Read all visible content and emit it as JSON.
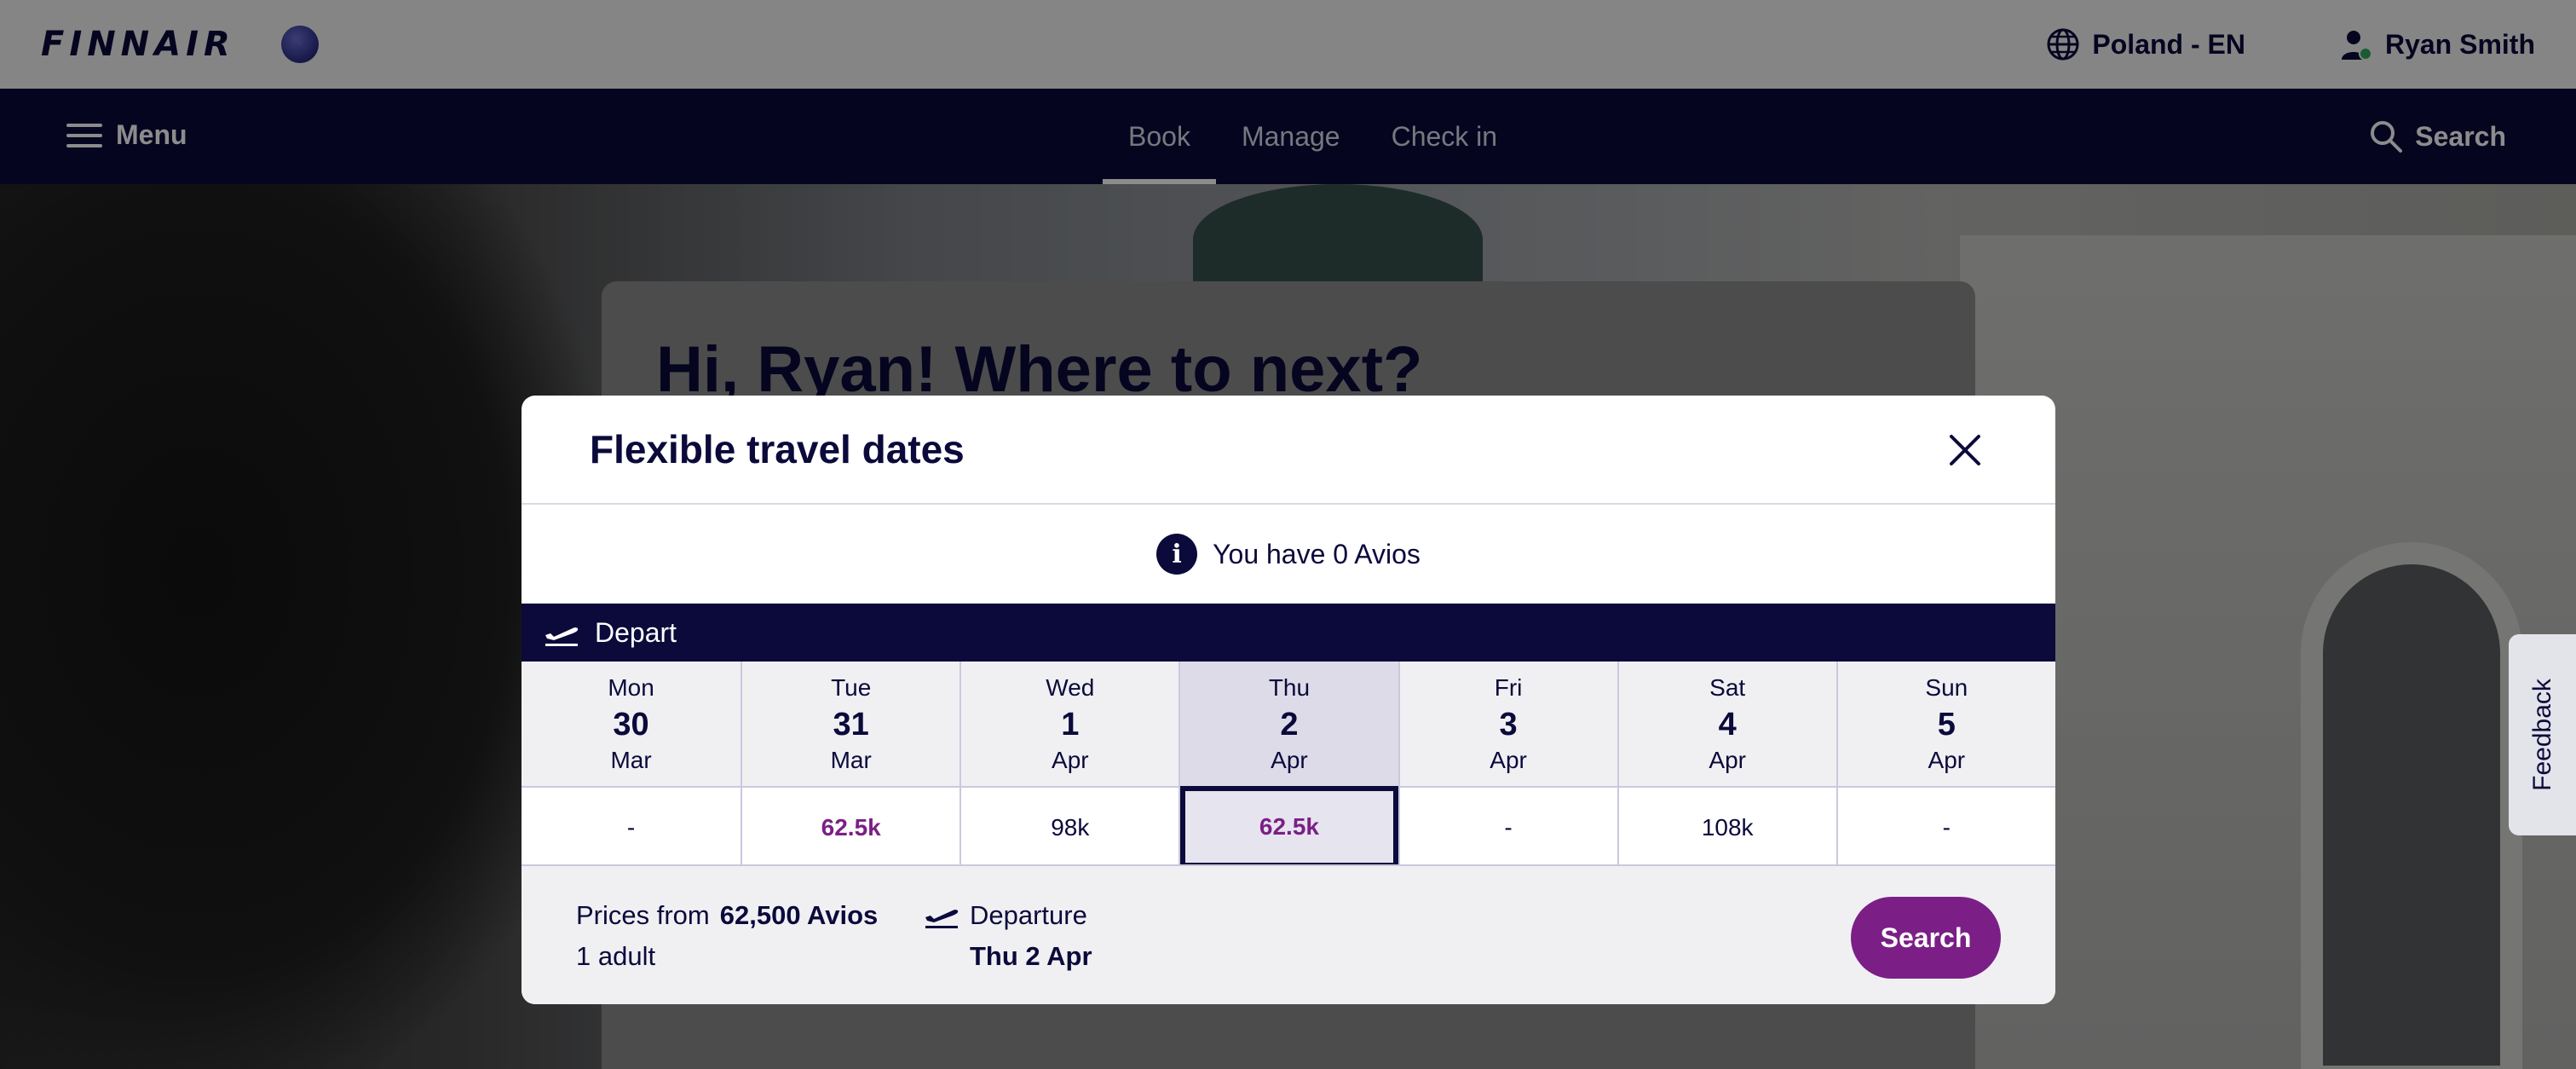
{
  "header": {
    "logo": "FINNAIR",
    "region": "Poland - EN",
    "user": "Ryan Smith"
  },
  "nav": {
    "menu_label": "Menu",
    "tabs": [
      {
        "label": "Book",
        "active": true
      },
      {
        "label": "Manage",
        "active": false
      },
      {
        "label": "Check in",
        "active": false
      }
    ],
    "search_label": "Search"
  },
  "hero": {
    "greeting": "Hi, Ryan! Where to next?"
  },
  "feedback": "Feedback",
  "modal": {
    "title": "Flexible travel dates",
    "avios_info": "You have 0 Avios",
    "depart_label": "Depart",
    "days": [
      {
        "dow": "Mon",
        "num": "30",
        "month": "Mar",
        "price": "-",
        "highlight": false,
        "selected": false
      },
      {
        "dow": "Tue",
        "num": "31",
        "month": "Mar",
        "price": "62.5k",
        "highlight": true,
        "selected": false
      },
      {
        "dow": "Wed",
        "num": "1",
        "month": "Apr",
        "price": "98k",
        "highlight": false,
        "selected": false
      },
      {
        "dow": "Thu",
        "num": "2",
        "month": "Apr",
        "price": "62.5k",
        "highlight": true,
        "selected": true
      },
      {
        "dow": "Fri",
        "num": "3",
        "month": "Apr",
        "price": "-",
        "highlight": false,
        "selected": false
      },
      {
        "dow": "Sat",
        "num": "4",
        "month": "Apr",
        "price": "108k",
        "highlight": false,
        "selected": false
      },
      {
        "dow": "Sun",
        "num": "5",
        "month": "Apr",
        "price": "-",
        "highlight": false,
        "selected": false
      }
    ],
    "footer": {
      "prices_from_label": "Prices from",
      "prices_from_value": "62,500 Avios",
      "passengers": "1 adult",
      "departure_label": "Departure",
      "departure_date": "Thu 2 Apr",
      "search_button": "Search"
    }
  },
  "colors": {
    "navy": "#0b0a3b",
    "purple": "#7b1f86",
    "light_gray": "#f0f0f3"
  }
}
